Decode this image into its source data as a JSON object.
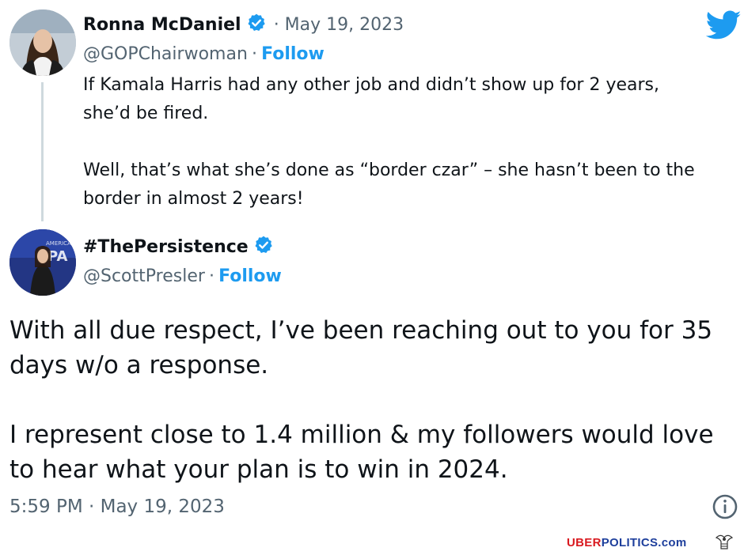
{
  "reply_tweet": {
    "display_name": "Ronna McDaniel",
    "date": "· May 19, 2023",
    "handle": "@GOPChairwoman",
    "separator": "·",
    "follow_label": "Follow",
    "text": "If Kamala Harris had any other job and didn’t show up for 2 years,\nshe’d be fired.\n\nWell, that’s what she’s done as “border czar” – she hasn’t been to the\nborder in almost 2 years!"
  },
  "main_tweet": {
    "display_name": "#ThePersistence",
    "handle": "@ScottPresler",
    "separator": "·",
    "follow_label": "Follow",
    "text": "With all due respect, I’ve been reaching out to you for 35\ndays w/o a response.\n\nI represent close to 1.4 million & my followers would love\nto hear what your plan is to win in 2024.",
    "timestamp": "5:59 PM · May 19, 2023"
  },
  "watermark": {
    "part1": "UBER",
    "part2": "POLITICS",
    "part3": ".com"
  },
  "icons": {
    "brand": "twitter-bird-icon",
    "verified": "verified-badge-icon",
    "info": "info-icon"
  },
  "colors": {
    "twitter_blue": "#1d9bf0",
    "text": "#0f1419",
    "secondary": "#536471",
    "watermark_red": "#d9191f",
    "watermark_blue": "#1e3f9c"
  }
}
